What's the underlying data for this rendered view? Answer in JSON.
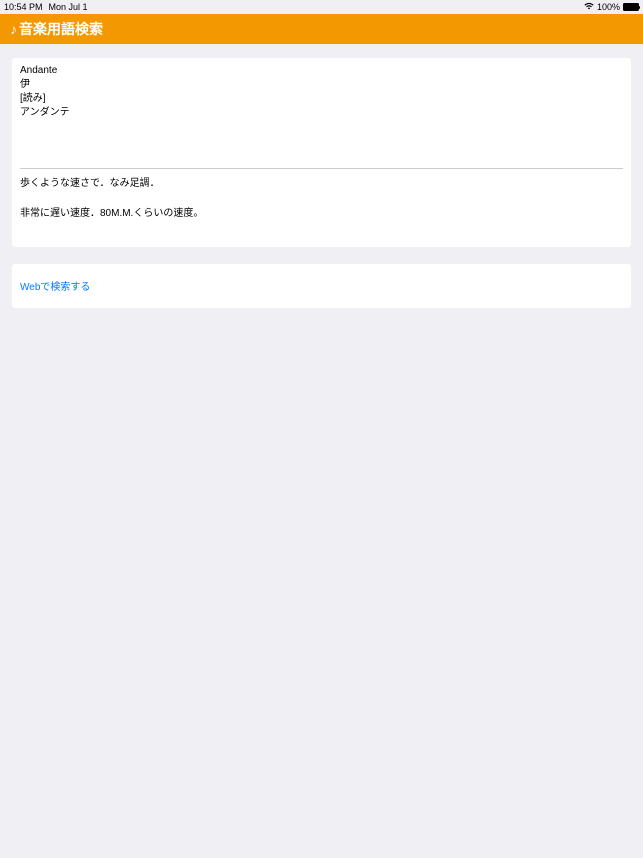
{
  "statusBar": {
    "time": "10:54 PM",
    "date": "Mon Jul 1",
    "battery": "100%"
  },
  "header": {
    "title": "音楽用語検索",
    "icon": "♪"
  },
  "term": {
    "name": "Andante",
    "origin": "伊",
    "readingLabel": "[読み]",
    "reading": "アンダンテ"
  },
  "definition": {
    "line1": "歩くような速さで．なみ足調．",
    "line2": "非常に遅い速度．80M.M.くらいの速度。"
  },
  "webSearch": {
    "label": "Webで検索する"
  }
}
